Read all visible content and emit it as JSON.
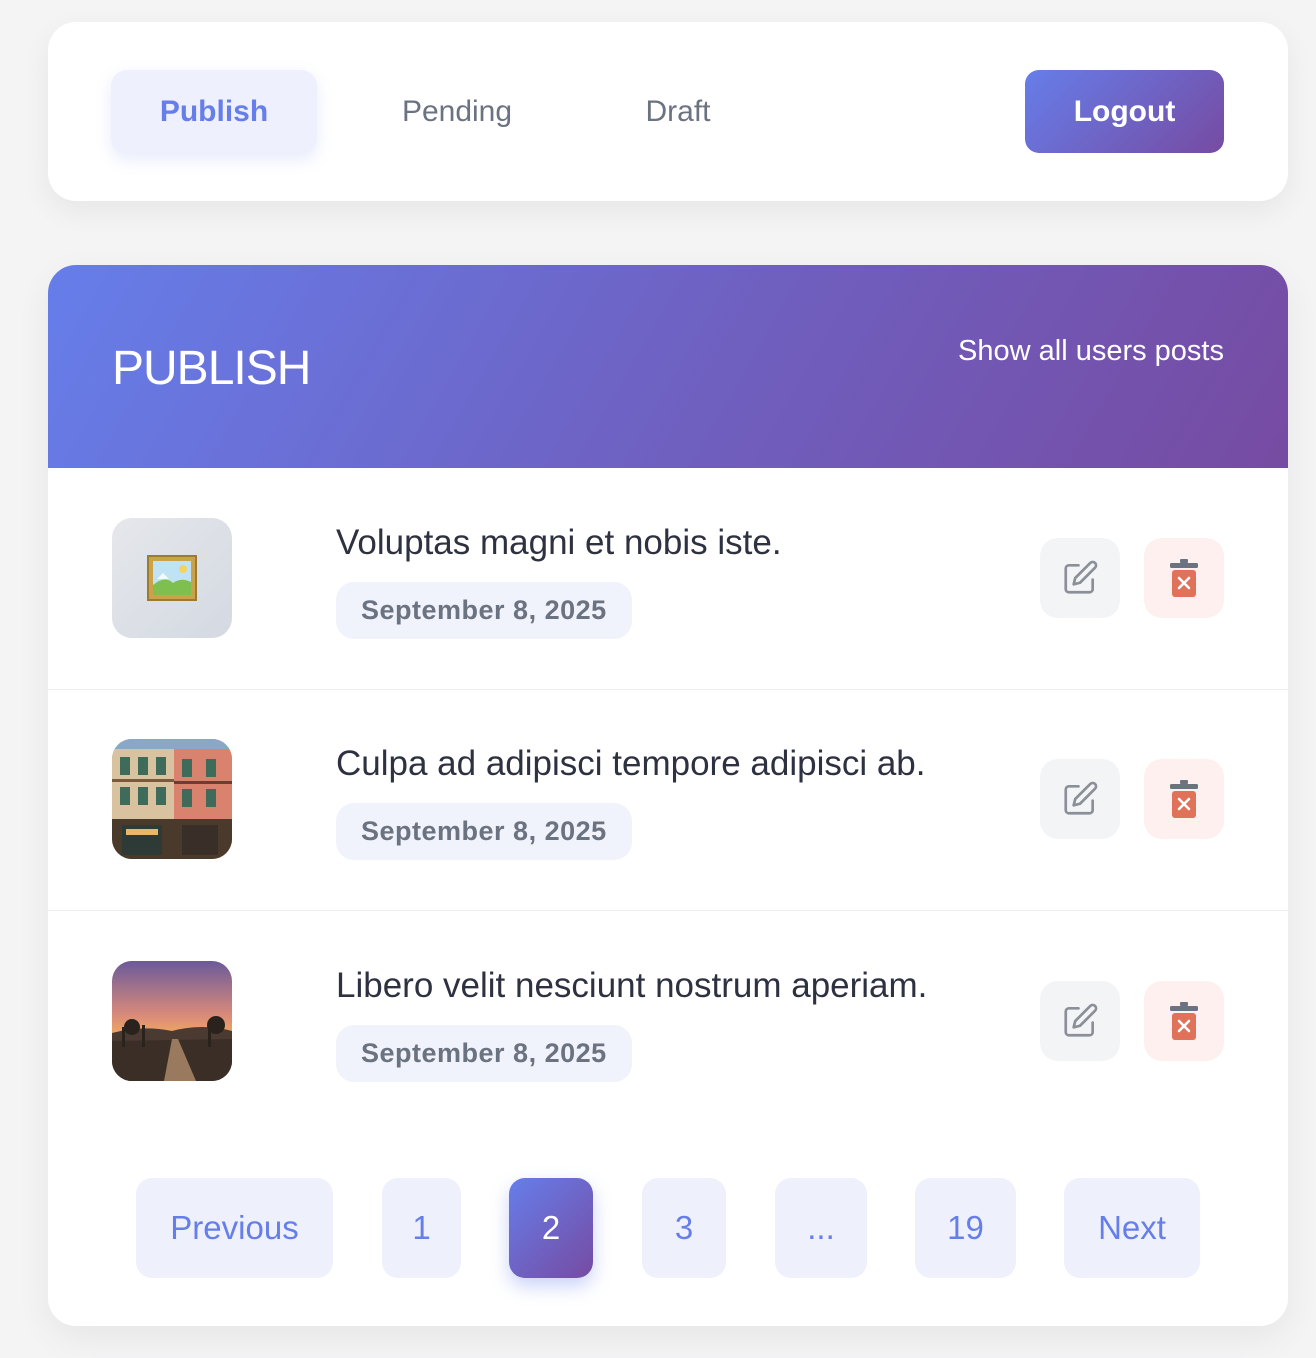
{
  "nav": {
    "tabs": [
      {
        "label": "Publish",
        "active": true
      },
      {
        "label": "Pending",
        "active": false
      },
      {
        "label": "Draft",
        "active": false
      }
    ],
    "logout_label": "Logout"
  },
  "header": {
    "title": "PUBLISH",
    "show_all_label": "Show all users posts"
  },
  "posts": [
    {
      "title": "Voluptas magni et nobis iste.",
      "date": "September 8, 2025",
      "thumbnail": "placeholder-frame-icon"
    },
    {
      "title": "Culpa ad adipisci tempore adipisci ab.",
      "date": "September 8, 2025",
      "thumbnail": "building-street-photo"
    },
    {
      "title": "Libero velit nesciunt nostrum aperiam.",
      "date": "September 8, 2025",
      "thumbnail": "sunset-path-photo"
    }
  ],
  "pagination": {
    "previous_label": "Previous",
    "pages": [
      "1",
      "2",
      "3",
      "...",
      "19"
    ],
    "current_page": "2",
    "next_label": "Next"
  },
  "colors": {
    "accent_start": "#667eea",
    "accent_end": "#764ba2",
    "delete_icon": "#e0725a",
    "title_text": "#2d3140"
  }
}
